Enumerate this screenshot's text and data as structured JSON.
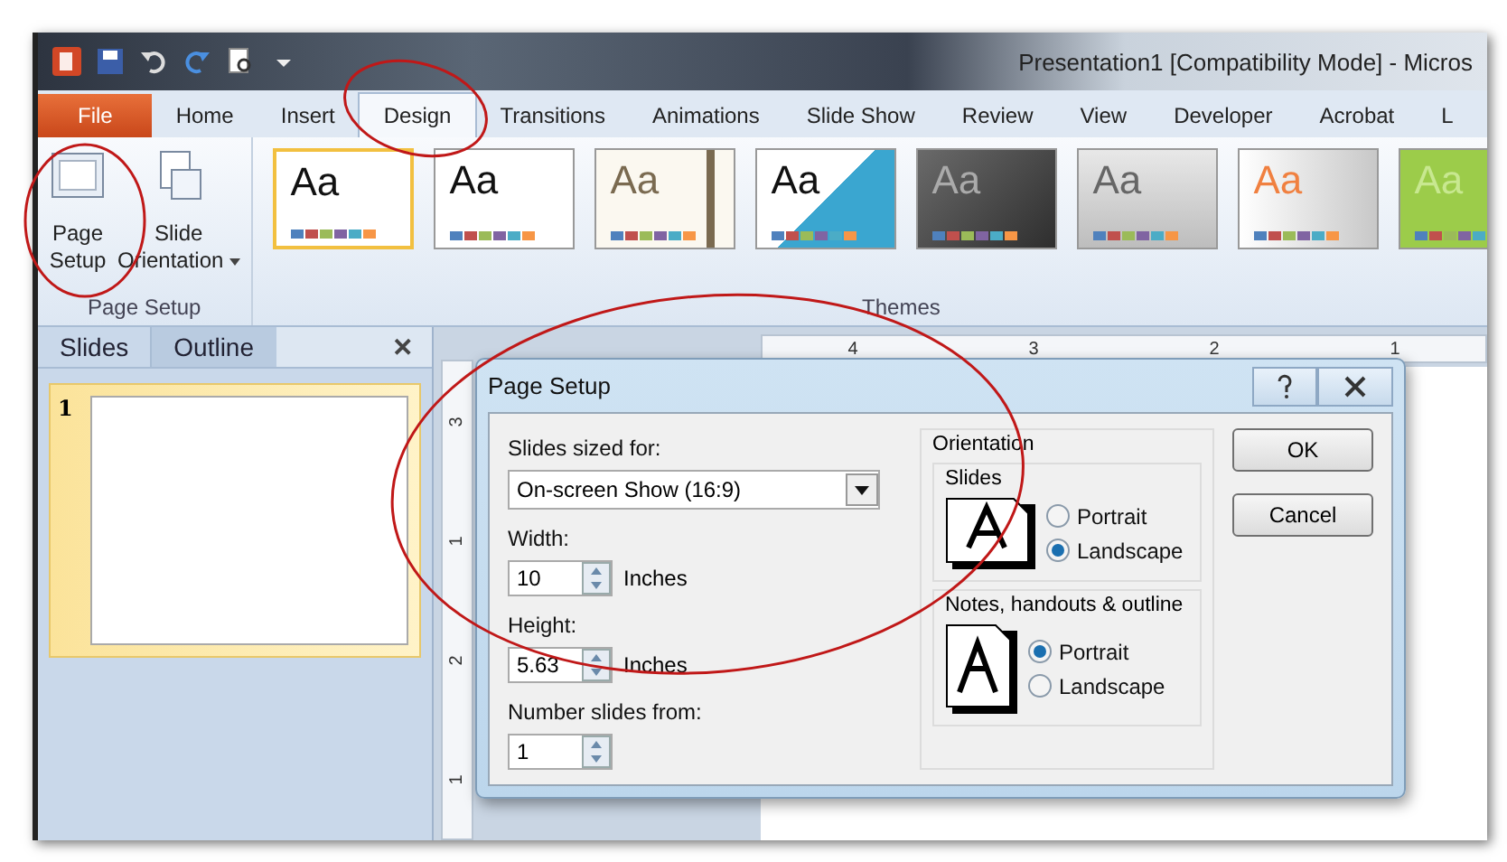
{
  "window": {
    "title": "Presentation1 [Compatibility Mode] - Micros"
  },
  "tabs": [
    {
      "label": "File",
      "kind": "file",
      "selected": false
    },
    {
      "label": "Home",
      "kind": "tab",
      "selected": false
    },
    {
      "label": "Insert",
      "kind": "tab",
      "selected": false
    },
    {
      "label": "Design",
      "kind": "tab",
      "selected": true
    },
    {
      "label": "Transitions",
      "kind": "tab",
      "selected": false
    },
    {
      "label": "Animations",
      "kind": "tab",
      "selected": false
    },
    {
      "label": "Slide Show",
      "kind": "tab",
      "selected": false
    },
    {
      "label": "Review",
      "kind": "tab",
      "selected": false
    },
    {
      "label": "View",
      "kind": "tab",
      "selected": false
    },
    {
      "label": "Developer",
      "kind": "tab",
      "selected": false
    },
    {
      "label": "Acrobat",
      "kind": "tab",
      "selected": false
    },
    {
      "label": "L",
      "kind": "tab",
      "selected": false
    }
  ],
  "ribbon": {
    "page_setup_group": {
      "label": "Page Setup",
      "buttons": [
        {
          "kind": "page",
          "lines": [
            "Page",
            "Setup"
          ]
        },
        {
          "kind": "orientation",
          "lines": [
            "Slide",
            "Orientation"
          ]
        }
      ]
    },
    "themes_group": {
      "label": "Themes",
      "themes": [
        {
          "sample": "Aa",
          "kind": "white",
          "selected": true
        },
        {
          "sample": "Aa",
          "kind": "plain",
          "selected": false
        },
        {
          "sample": "Aa",
          "kind": "cream",
          "selected": false
        },
        {
          "sample": "Aa",
          "kind": "angles",
          "selected": false
        },
        {
          "sample": "Aa",
          "kind": "dark",
          "selected": false
        },
        {
          "sample": "Aa",
          "kind": "grey",
          "selected": false
        },
        {
          "sample": "Aa",
          "kind": "orange",
          "selected": false
        },
        {
          "sample": "Aa",
          "kind": "green",
          "selected": false
        }
      ]
    }
  },
  "pane": {
    "tabs": [
      {
        "label": "Slides",
        "selected": true
      },
      {
        "label": "Outline",
        "selected": false
      }
    ],
    "close": "✕",
    "slides": [
      {
        "number": "1",
        "selected": true
      }
    ]
  },
  "rulers": {
    "horizontal": [
      "4",
      "3",
      "2",
      "1"
    ],
    "vertical": [
      "3",
      "1",
      "2",
      "1"
    ]
  },
  "dialog": {
    "title": "Page Setup",
    "sized_for": {
      "label": "Slides sized for:",
      "value": "On-screen Show (16:9)"
    },
    "width": {
      "label": "Width:",
      "value": "10",
      "unit": "Inches"
    },
    "height": {
      "label": "Height:",
      "value": "5.63",
      "unit": "Inches"
    },
    "number_from": {
      "label": "Number slides from:",
      "value": "1"
    },
    "orientation": {
      "label": "Orientation",
      "groups": [
        {
          "label": "Slides",
          "kind": "landscape",
          "options": [
            {
              "label": "Portrait",
              "selected": false
            },
            {
              "label": "Landscape",
              "selected": true
            }
          ]
        },
        {
          "label": "Notes, handouts & outline",
          "kind": "portrait",
          "options": [
            {
              "label": "Portrait",
              "selected": true
            },
            {
              "label": "Landscape",
              "selected": false
            }
          ]
        }
      ]
    },
    "buttons": [
      "OK",
      "Cancel"
    ]
  }
}
